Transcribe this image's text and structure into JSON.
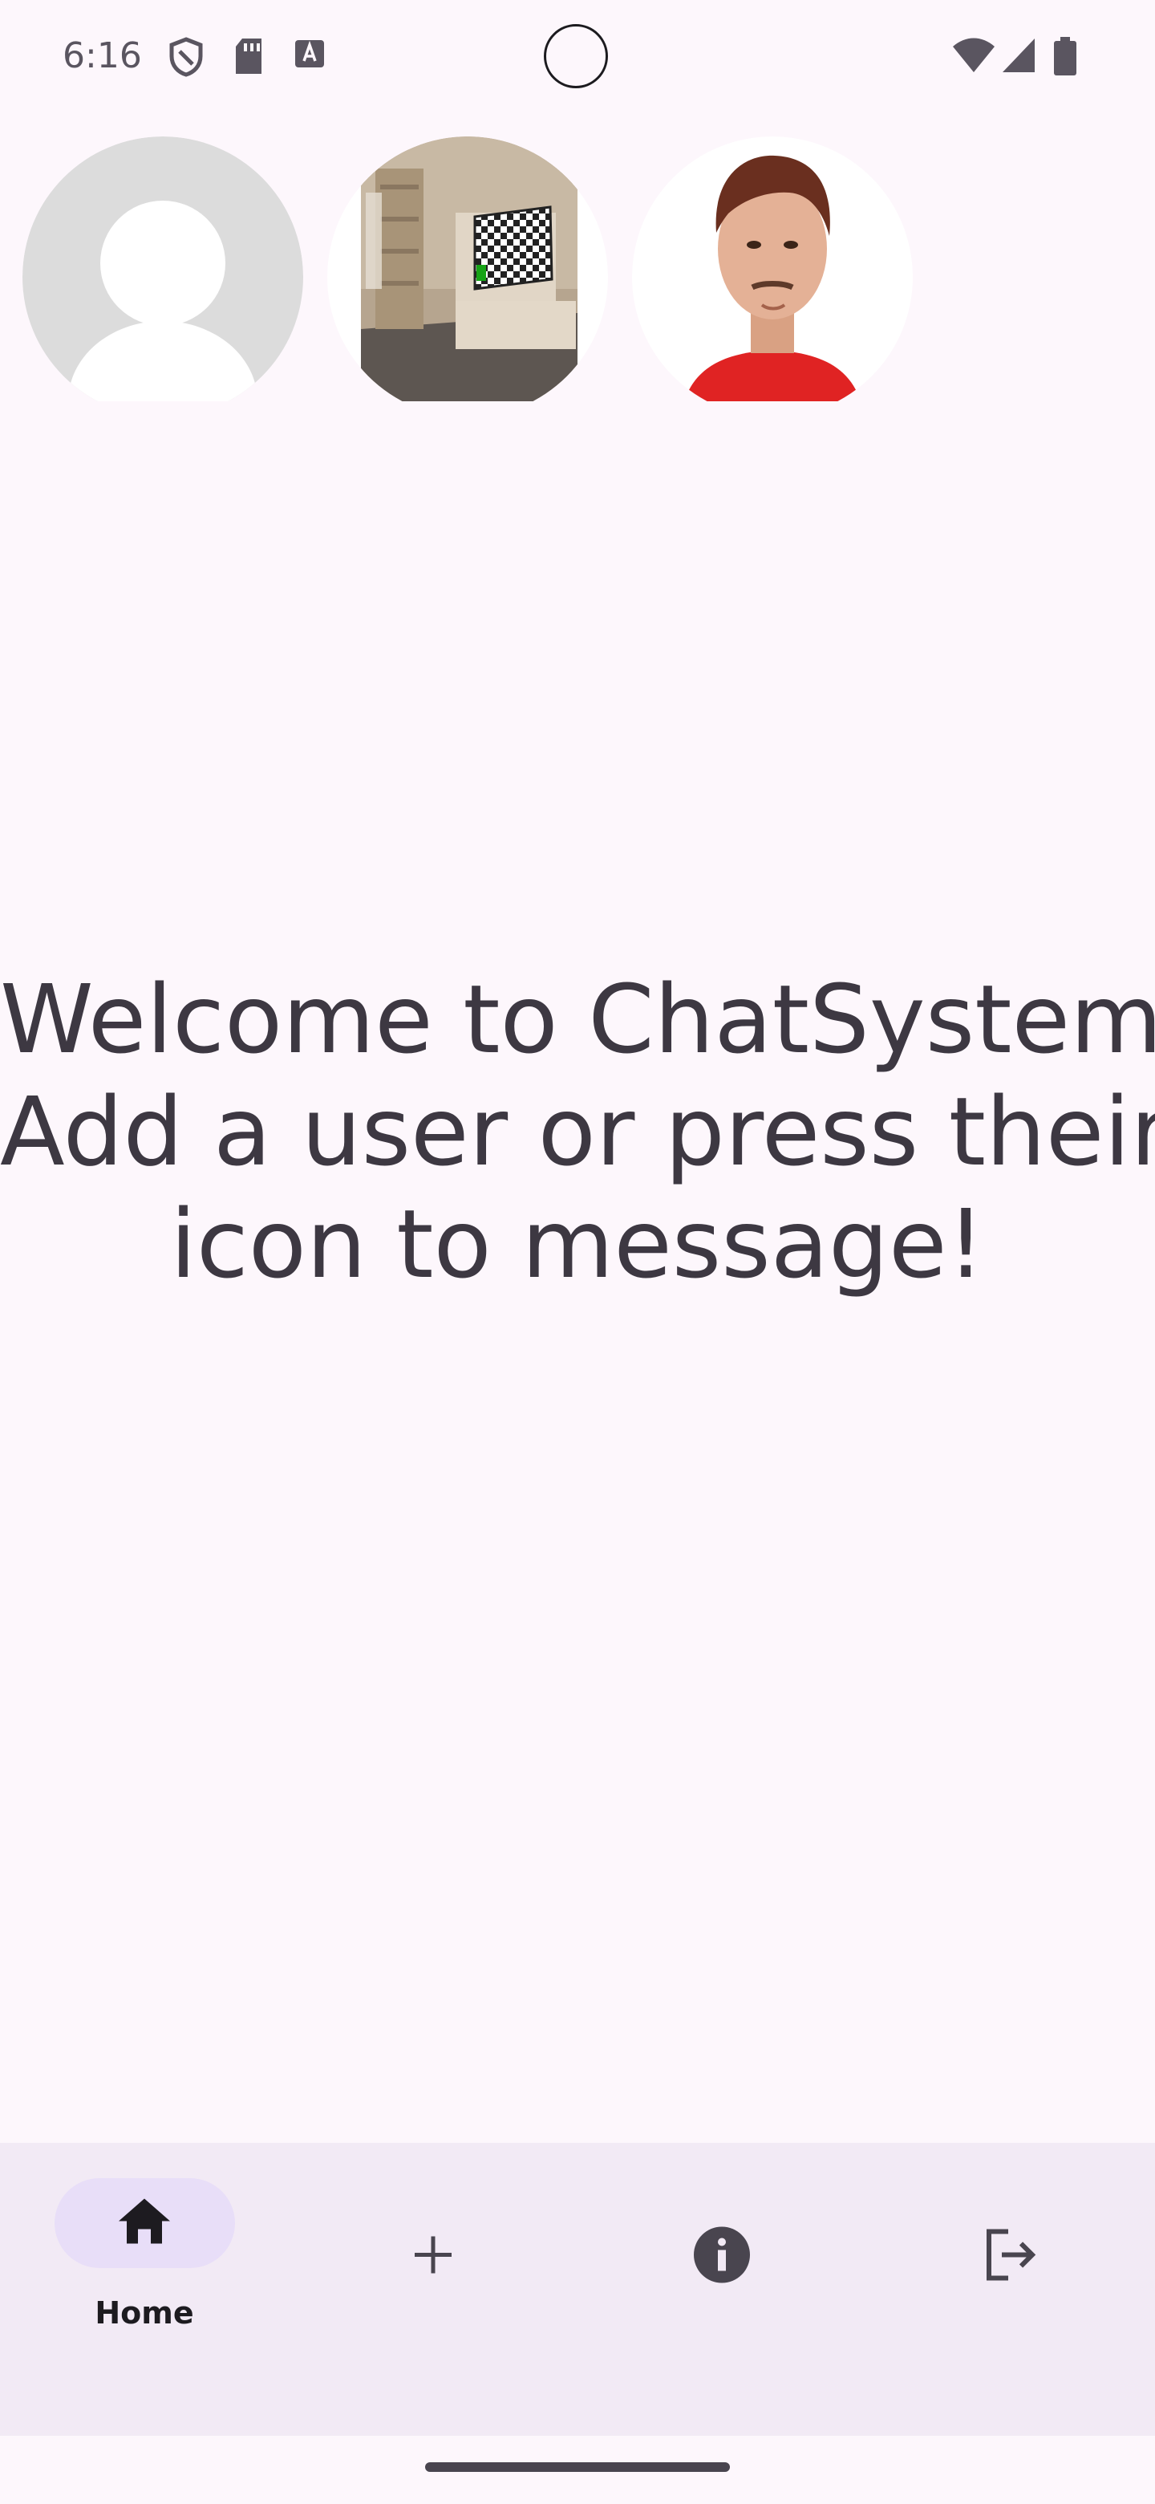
{
  "status_bar": {
    "time": "6:16",
    "icons": [
      "shield-icon",
      "sd-card-icon",
      "keyboard-a-icon",
      "wifi-icon",
      "signal-icon",
      "battery-icon"
    ]
  },
  "avatars": [
    {
      "name": "default-avatar"
    },
    {
      "name": "room-avatar"
    },
    {
      "name": "person-avatar"
    }
  ],
  "welcome": {
    "line1": "Welcome to ChatSystem!",
    "line2": "Add a user or press their",
    "line3": "icon to message!"
  },
  "nav": {
    "items": [
      {
        "label": "Home",
        "icon": "home-icon",
        "selected": true
      },
      {
        "label": "",
        "icon": "add-icon",
        "selected": false
      },
      {
        "label": "",
        "icon": "info-icon",
        "selected": false
      },
      {
        "label": "",
        "icon": "logout-icon",
        "selected": false
      }
    ]
  },
  "colors": {
    "background": "#fdf7fc",
    "nav_background": "#f2eaf5",
    "nav_pill": "#e8def8",
    "text": "#3d3842"
  }
}
